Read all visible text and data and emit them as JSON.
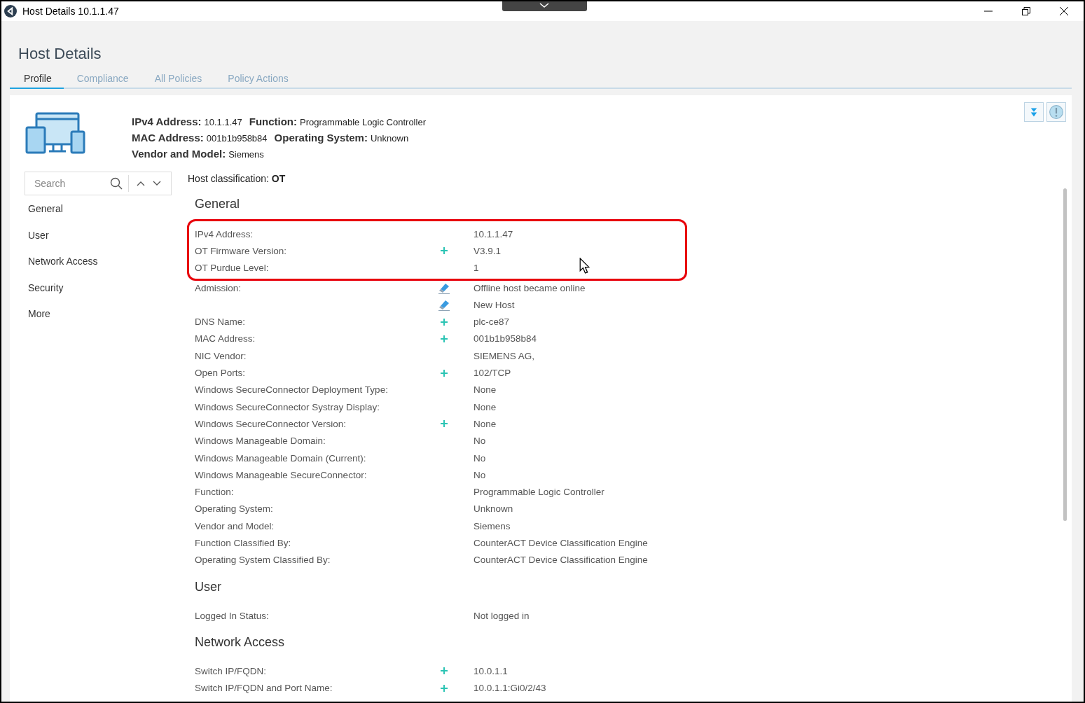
{
  "window": {
    "title": "Host Details 10.1.1.47"
  },
  "page_title": "Host Details",
  "tabs": [
    {
      "label": "Profile",
      "selected": true
    },
    {
      "label": "Compliance",
      "selected": false
    },
    {
      "label": "All Policies",
      "selected": false
    },
    {
      "label": "Policy Actions",
      "selected": false
    }
  ],
  "summary": [
    [
      {
        "label": "IPv4 Address:",
        "value": "10.1.1.47"
      },
      {
        "label": "Function:",
        "value": "Programmable Logic Controller"
      }
    ],
    [
      {
        "label": "MAC Address:",
        "value": "001b1b958b84"
      },
      {
        "label": "Operating System:",
        "value": "Unknown"
      }
    ],
    [
      {
        "label": "Vendor and Model:",
        "value": "Siemens"
      }
    ]
  ],
  "search": {
    "placeholder": "Search"
  },
  "sidebar": {
    "items": [
      {
        "label": "General"
      },
      {
        "label": "User"
      },
      {
        "label": "Network Access"
      },
      {
        "label": "Security"
      },
      {
        "label": "More"
      }
    ]
  },
  "classification": "Host classification: **OT**",
  "sections": [
    {
      "title": "General",
      "rows": [
        {
          "label": "IPv4 Address:",
          "value": "10.1.1.47",
          "highlighted": true
        },
        {
          "label": "OT Firmware Version:",
          "kind": "plus",
          "value": "V3.9.1",
          "highlighted": true
        },
        {
          "label": "OT Purdue Level:",
          "value": "1",
          "highlighted": true
        },
        {
          "label": "Admission:",
          "kind": "eraser",
          "value": "Offline host became online",
          "highlighted": false
        },
        {
          "kind": "eraser",
          "value": "New Host",
          "highlighted": false
        },
        {
          "label": "DNS Name:",
          "kind": "plus",
          "value": "plc-ce87",
          "highlighted": false
        },
        {
          "label": "MAC Address:",
          "kind": "plus",
          "value": "001b1b958b84",
          "highlighted": false
        },
        {
          "label": "NIC Vendor:",
          "value": "SIEMENS AG,",
          "highlighted": false
        },
        {
          "label": "Open Ports:",
          "kind": "plus",
          "value": "102/TCP",
          "highlighted": false
        },
        {
          "label": "Windows SecureConnector Deployment Type:",
          "value": "None",
          "highlighted": false
        },
        {
          "label": "Windows SecureConnector Systray Display:",
          "value": "None",
          "highlighted": false
        },
        {
          "label": "Windows SecureConnector Version:",
          "kind": "plus",
          "value": "None",
          "highlighted": false
        },
        {
          "label": "Windows Manageable Domain:",
          "value": "No",
          "highlighted": false
        },
        {
          "label": "Windows Manageable Domain (Current):",
          "value": "No",
          "highlighted": false
        },
        {
          "label": "Windows Manageable SecureConnector:",
          "value": "No",
          "highlighted": false
        },
        {
          "label": "Function:",
          "value": "Programmable Logic Controller",
          "highlighted": false
        },
        {
          "label": "Operating System:",
          "value": "Unknown",
          "highlighted": false
        },
        {
          "label": "Vendor and Model:",
          "value": "Siemens",
          "highlighted": false
        },
        {
          "label": "Function Classified By:",
          "value": "CounterACT Device Classification Engine",
          "highlighted": false
        },
        {
          "label": "Operating System Classified By:",
          "value": "CounterACT Device Classification Engine",
          "highlighted": false
        }
      ]
    },
    {
      "title": "User",
      "rows": [
        {
          "label": "Logged In Status:",
          "value": "Not logged in",
          "highlighted": false
        }
      ]
    },
    {
      "title": "Network Access",
      "rows": [
        {
          "label": "Switch IP/FQDN:",
          "kind": "plus",
          "value": "10.0.1.1",
          "highlighted": false
        },
        {
          "label": "Switch IP/FQDN and Port Name:",
          "kind": "plus",
          "value": "10.0.1.1:Gi0/2/43",
          "highlighted": false
        }
      ]
    }
  ]
}
